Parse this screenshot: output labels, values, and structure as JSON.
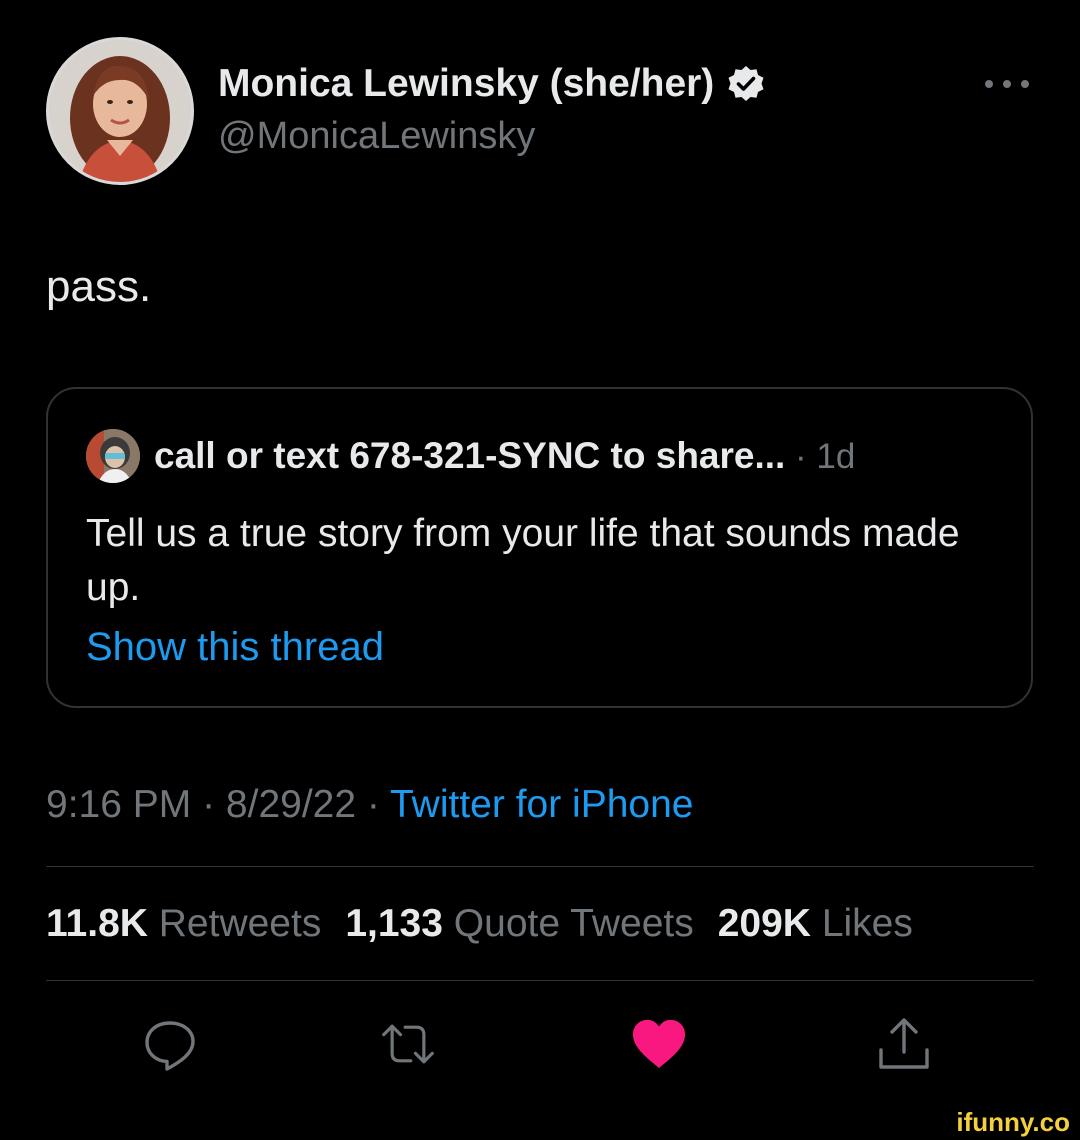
{
  "author": {
    "name": "Monica Lewinsky (she/her)",
    "handle": "@MonicaLewinsky",
    "verified": true
  },
  "tweet": {
    "text": "pass."
  },
  "quoted_tweet": {
    "author": "call or text 678-321-SYNC to share...",
    "time_prefix": " · ",
    "time": "1d",
    "text": "Tell us a true story from your life that sounds made up.",
    "show_thread_label": "Show this thread"
  },
  "meta": {
    "time": "9:16 PM",
    "sep1": " · ",
    "date": "8/29/22",
    "sep2": " · ",
    "source": "Twitter for iPhone"
  },
  "stats": {
    "retweets_count": "11.8K",
    "retweets_label": "Retweets",
    "quotes_count": "1,133",
    "quotes_label": "Quote Tweets",
    "likes_count": "209K",
    "likes_label": "Likes"
  },
  "actions": {
    "reply_icon": "reply-icon",
    "retweet_icon": "retweet-icon",
    "like_icon": "heart-icon",
    "like_active": true,
    "share_icon": "share-icon"
  },
  "colors": {
    "background": "#000000",
    "link": "#1d9bf0",
    "secondary_text": "#71767b",
    "like": "#f91880"
  },
  "watermark": {
    "text": "ifunny.co"
  }
}
